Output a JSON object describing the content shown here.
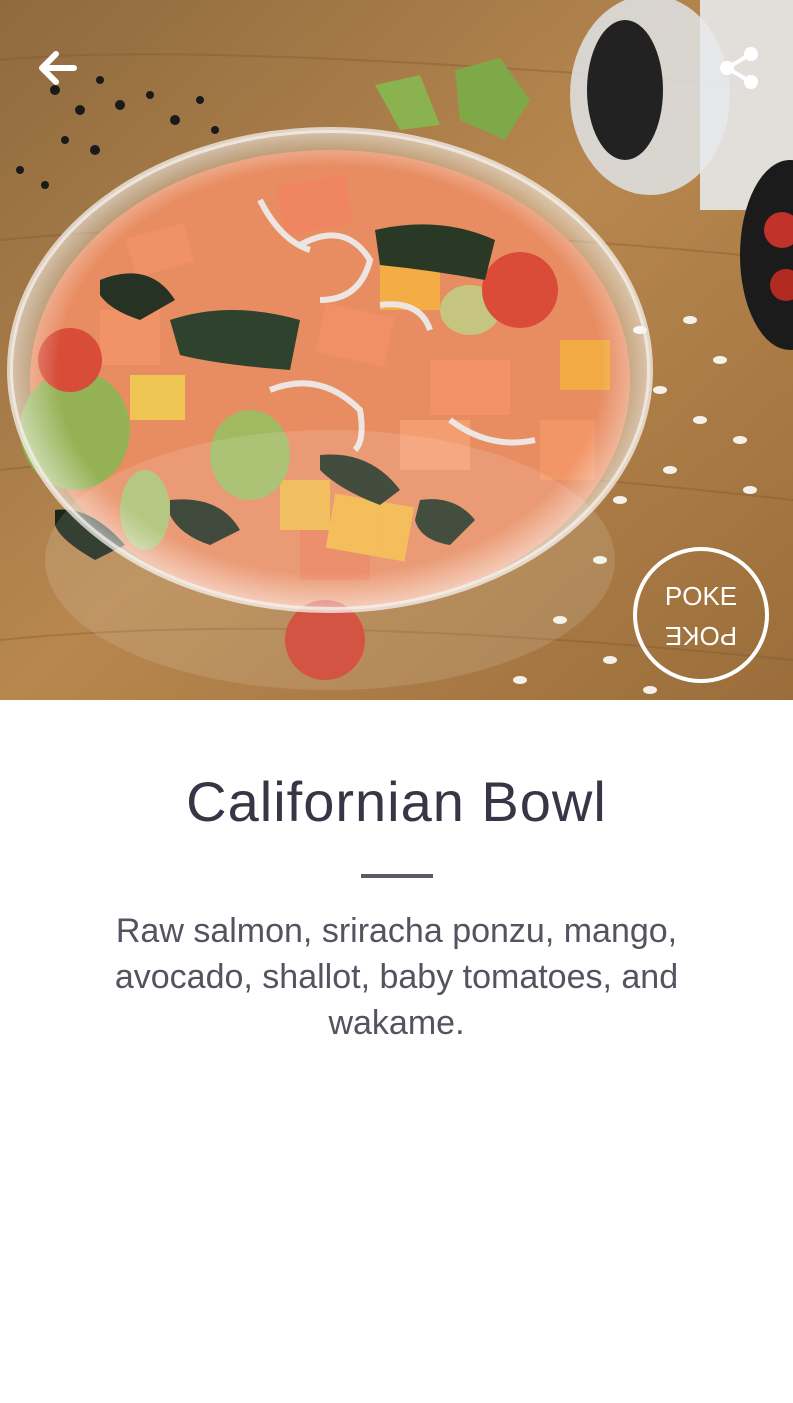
{
  "hero": {
    "image_alt": "Poke bowl with salmon, mango, avocado, wakame and tomatoes",
    "logo": {
      "line1": "POKE",
      "line2": "POKE"
    }
  },
  "toolbar": {
    "back_icon": "arrow-left-icon",
    "share_icon": "share-icon"
  },
  "dish": {
    "name": "Californian Bowl",
    "description": "Raw salmon, sriracha ponzu, mango, avocado, shallot, baby tomatoes, and wakame."
  },
  "colors": {
    "title": "#363646",
    "description": "#54535f",
    "divider": "#5a5966"
  }
}
